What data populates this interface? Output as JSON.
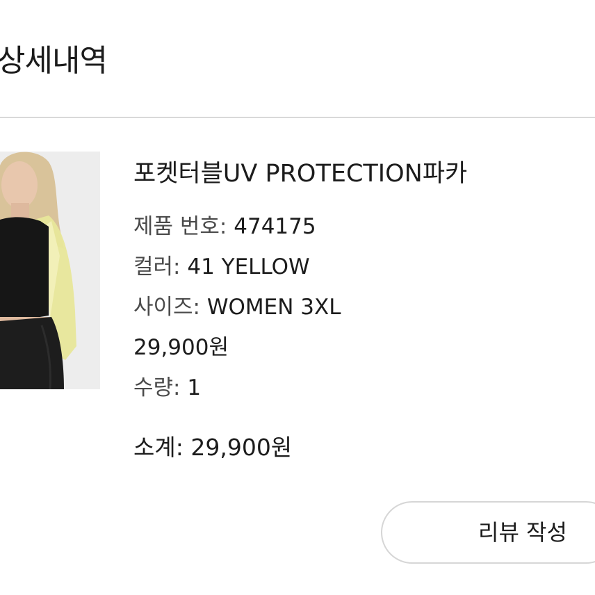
{
  "header": {
    "title": "상세내역"
  },
  "product": {
    "image_icon": "product-photo",
    "name": "포켓터블UV PROTECTION파카",
    "product_number_label": "제품 번호:",
    "product_number": "474175",
    "color_label": "컬러:",
    "color": "41 YELLOW",
    "size_label": "사이즈:",
    "size": "WOMEN 3XL",
    "price": "29,900원",
    "quantity_label": "수량:",
    "quantity": "1"
  },
  "summary": {
    "subtotal_label": "소계:",
    "subtotal": "29,900원"
  },
  "actions": {
    "review_label": "리뷰 작성"
  },
  "colors": {
    "divider": "#d9d9d9",
    "button_border": "#d6d6d6",
    "text": "#1c1c1c"
  }
}
